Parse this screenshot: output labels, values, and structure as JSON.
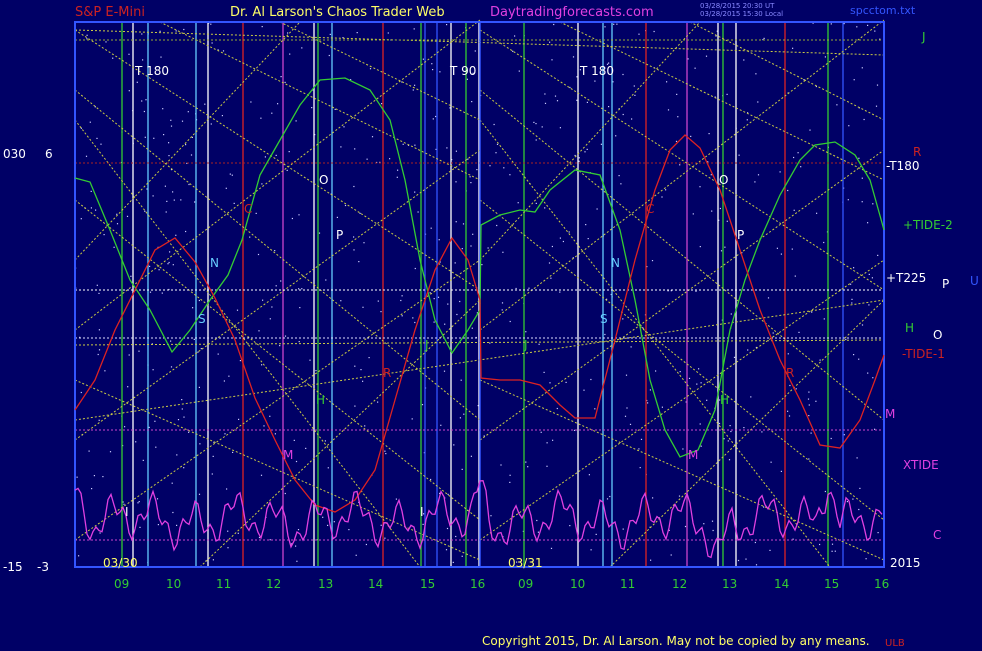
{
  "header": {
    "left_title": "S&P E-Mini",
    "center_title": "Dr. Al Larson's Chaos Trader Web",
    "site": "Daytradingforecasts.com",
    "stamp_line1": "03/28/2015 20:30 UT",
    "stamp_line2": "03/28/2015 15:30 Local",
    "file": "spcctom.txt"
  },
  "footer": {
    "copyright": "Copyright 2015, Dr. Al Larson. May not be copied by any means.",
    "corner": "ULB"
  },
  "year": "2015",
  "left_scale": {
    "top_a": "030",
    "top_b": "6",
    "bottom_a": "-15",
    "bottom_b": "-3"
  },
  "days": [
    "03/30",
    "03/31"
  ],
  "x_ticks": [
    "09",
    "10",
    "11",
    "12",
    "13",
    "14",
    "15",
    "16"
  ],
  "cycle_labels": {
    "t180": "T 180",
    "t90": "T 90"
  },
  "right_labels": {
    "j": "J",
    "r": "R",
    "t180": "-T180",
    "tide2": "+TIDE-2",
    "t225": "+T225",
    "p": "P",
    "u": "U",
    "h": "H",
    "o": "O",
    "tide1": "-TIDE-1",
    "m": "M",
    "xtide": "XTIDE",
    "c": "C"
  },
  "planet_letters": {
    "o": "O",
    "p": "P",
    "n": "N",
    "s": "S",
    "c": "C",
    "r": "R",
    "m": "M",
    "h": "H",
    "j": "J",
    "i": "I"
  },
  "colors": {
    "background": "#000066",
    "green_line": "#33cc33",
    "red_line": "#dd2222",
    "magenta_line": "#e040e0",
    "yellow_grid": "#cccc44",
    "frame": "#3355ff"
  },
  "chart_data": {
    "type": "line",
    "series": [
      {
        "name": "+TIDE-2",
        "color": "#33cc33"
      },
      {
        "name": "-TIDE-1",
        "color": "#dd2222"
      },
      {
        "name": "XTIDE",
        "color": "#e040e0"
      }
    ]
  }
}
